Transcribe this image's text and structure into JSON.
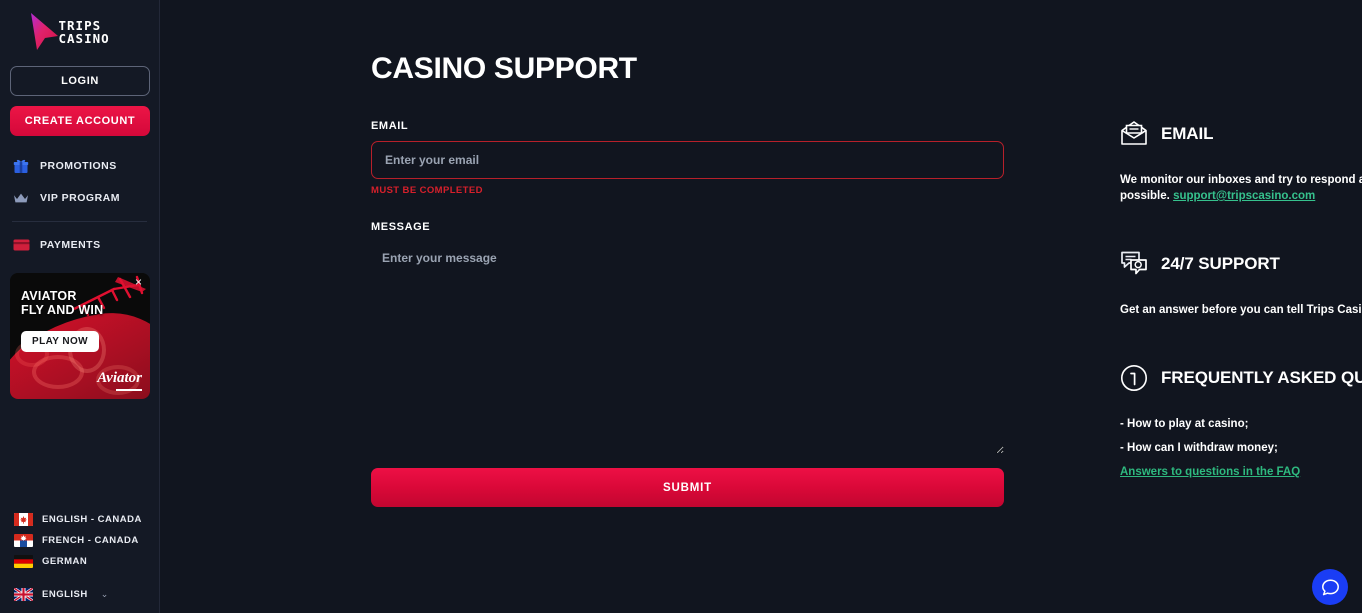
{
  "brand": {
    "logo_line1": "TRIPS",
    "logo_line2": "CASINO",
    "accent_pink": "#ec1546",
    "accent_green": "#2eb97f",
    "bg_dark": "#11151f",
    "sidebar_bg": "#141925"
  },
  "sidebar": {
    "login_label": "LOGIN",
    "create_account_label": "CREATE ACCOUNT",
    "nav": [
      {
        "icon": "gift-icon",
        "label": "PROMOTIONS"
      },
      {
        "icon": "crown-icon",
        "label": "VIP PROGRAM"
      },
      {
        "icon": "credit-card-icon",
        "label": "PAYMENTS"
      }
    ],
    "banner": {
      "title_line1": "AVIATOR",
      "title_line2": "FLY AND WIN",
      "cta_label": "PLAY NOW",
      "brand_label": "Aviator",
      "close_label": "×"
    },
    "languages": [
      {
        "flag": "ca",
        "label": "ENGLISH - CANADA"
      },
      {
        "flag": "qc",
        "label": "FRENCH - CANADA"
      },
      {
        "flag": "de",
        "label": "GERMAN"
      }
    ],
    "language_current": {
      "flag": "gb",
      "label": "ENGLISH",
      "chevron": "⌄"
    }
  },
  "main": {
    "page_title": "CASINO SUPPORT",
    "email_label": "EMAIL",
    "email_value": "",
    "email_placeholder": "Enter your email",
    "email_error": "MUST BE COMPLETED",
    "message_label": "MESSAGE",
    "message_value": "",
    "message_placeholder": "Enter your message",
    "submit_label": "SUBMIT"
  },
  "info": {
    "email_block": {
      "icon": "envelope-icon",
      "title": "EMAIL",
      "text": "We monitor our inboxes and try to respond as quickly as possible.",
      "link": "support@tripscasino.com"
    },
    "support_block": {
      "icon": "chat-bubbles-icon",
      "title": "24/7 SUPPORT",
      "text": "Get an answer before you can tell Trips Casino!"
    },
    "faq_block": {
      "icon": "info-circle-icon",
      "title": "FREQUENTLY ASKED QUESTIONS",
      "items": [
        "- How to play at casino;",
        "- How can I withdraw money;"
      ],
      "link": "Answers to questions in the FAQ"
    }
  },
  "chat_widget": {
    "icon": "chat-bubble-icon",
    "color": "#1a3df5"
  }
}
